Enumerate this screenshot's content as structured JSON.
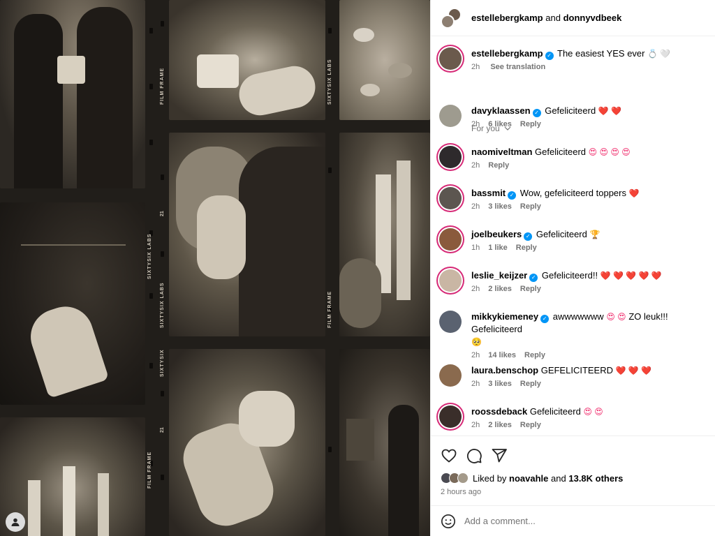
{
  "header": {
    "user1": "estellebergkamp",
    "joiner": "and",
    "user2": "donnyvdbeek"
  },
  "caption": {
    "username": "estellebergkamp",
    "text": "The easiest YES ever",
    "emojis": "💍 🤍",
    "time": "2h",
    "see_translation": "See translation"
  },
  "for_you_label": "For you",
  "film_labels": {
    "frame": "FILM FRAME",
    "labs": "SIXTYSIX LABS",
    "sixty": "SIXTYSIX",
    "number": "21"
  },
  "comments": [
    {
      "username": "davyklaassen",
      "verified": true,
      "text": "Gefeliciteerd",
      "emoji": "❤️ ❤️",
      "time": "2h",
      "likes": "6 likes",
      "reply": "Reply",
      "avatar_color": "#9e9b8f"
    },
    {
      "username": "naomiveltman",
      "verified": false,
      "text": "Gefeliciteerd",
      "emoji": "😍 😍 😍 😍",
      "time": "2h",
      "likes": "",
      "reply": "Reply",
      "avatar_color": "#2e2a2c"
    },
    {
      "username": "bassmit",
      "verified": true,
      "text": "Wow, gefeliciteerd toppers",
      "emoji": "❤️",
      "time": "2h",
      "likes": "3 likes",
      "reply": "Reply",
      "avatar_color": "#5c5650"
    },
    {
      "username": "joelbeukers",
      "verified": true,
      "text": "Gefeliciteerd",
      "emoji": "🏆",
      "time": "1h",
      "likes": "1 like",
      "reply": "Reply",
      "avatar_color": "#8a5a3c"
    },
    {
      "username": "leslie_keijzer",
      "verified": true,
      "text": "Gefeliciteerd!!",
      "emoji": "❤️ ❤️ ❤️ ❤️ ❤️",
      "time": "2h",
      "likes": "2 likes",
      "reply": "Reply",
      "avatar_color": "#c9b6a4"
    },
    {
      "username": "mikkykiemeney",
      "verified": true,
      "text": "awwwwwww",
      "emoji": "😍 😍",
      "text2": "ZO leuk!!! Gefeliciteerd",
      "emoji2": "🥺",
      "time": "2h",
      "likes": "14 likes",
      "reply": "Reply",
      "avatar_color": "#5a6270"
    },
    {
      "username": "laura.benschop",
      "verified": false,
      "text": "GEFELICITEERD",
      "emoji": "❤️ ❤️ ❤️",
      "time": "2h",
      "likes": "3 likes",
      "reply": "Reply",
      "avatar_color": "#8a6a4e"
    },
    {
      "username": "roossdeback",
      "verified": false,
      "text": "Gefeliciteerd",
      "emoji": "😍 😍",
      "time": "2h",
      "likes": "2 likes",
      "reply": "Reply",
      "avatar_color": "#3a2e2a"
    }
  ],
  "likes": {
    "prefix": "Liked by",
    "user": "noavahle",
    "joiner": "and",
    "others": "13.8K others"
  },
  "timestamp": "2 hours ago",
  "add_comment": {
    "placeholder": "Add a comment..."
  },
  "icons": {
    "like": "heart-icon",
    "comment": "comment-icon",
    "share": "send-icon",
    "emoji": "smiley-icon",
    "verified": "verified-badge-icon",
    "chevron": "chevron-down-icon"
  },
  "colors": {
    "link": "#00376b",
    "muted": "#737373",
    "verified": "#0095f6",
    "story_ring": "#d62976",
    "heart": "#f02a6b"
  }
}
